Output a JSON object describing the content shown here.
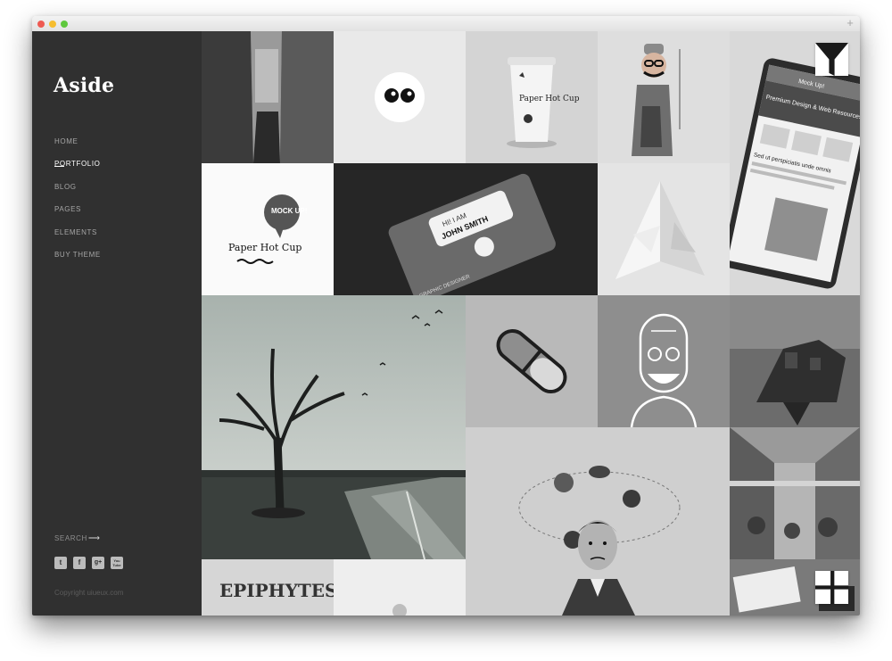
{
  "brand": {
    "name": "Aside"
  },
  "menu": [
    {
      "label": "HOME",
      "active": false
    },
    {
      "label": "PORTFOLIO",
      "active": true
    },
    {
      "label": "BLOG",
      "active": false
    },
    {
      "label": "PAGES",
      "active": false
    },
    {
      "label": "ELEMENTS",
      "active": false
    },
    {
      "label": "BUY THEME",
      "active": false
    }
  ],
  "search": {
    "label": "SEARCH"
  },
  "social": [
    {
      "icon": "twitter-icon",
      "glyph": "t"
    },
    {
      "icon": "facebook-icon",
      "glyph": "f"
    },
    {
      "icon": "google-plus-icon",
      "glyph": "g+"
    },
    {
      "icon": "youtube-icon",
      "glyph": "You Tube"
    }
  ],
  "footer": {
    "copyright": "Copyright uiueux.com"
  },
  "portfolio": {
    "cup_text": "Paper Hot Cup",
    "mock_text": "MOCK UP!",
    "card_hi": "HI! I AM",
    "card_name": "JOHN SMITH",
    "card_role": "GRAPHIC DESIGNER",
    "phone_header": "Mock Up!",
    "phone_title": "Premium Design & Web Resources",
    "phone_subtitle": "Sed ut perspiciatis unde omnis",
    "epiphytes_text": "EPIPHYTES"
  },
  "colors": {
    "sidebar": "#303030",
    "accent": "#ffffff",
    "muted": "#a6a6a6"
  }
}
